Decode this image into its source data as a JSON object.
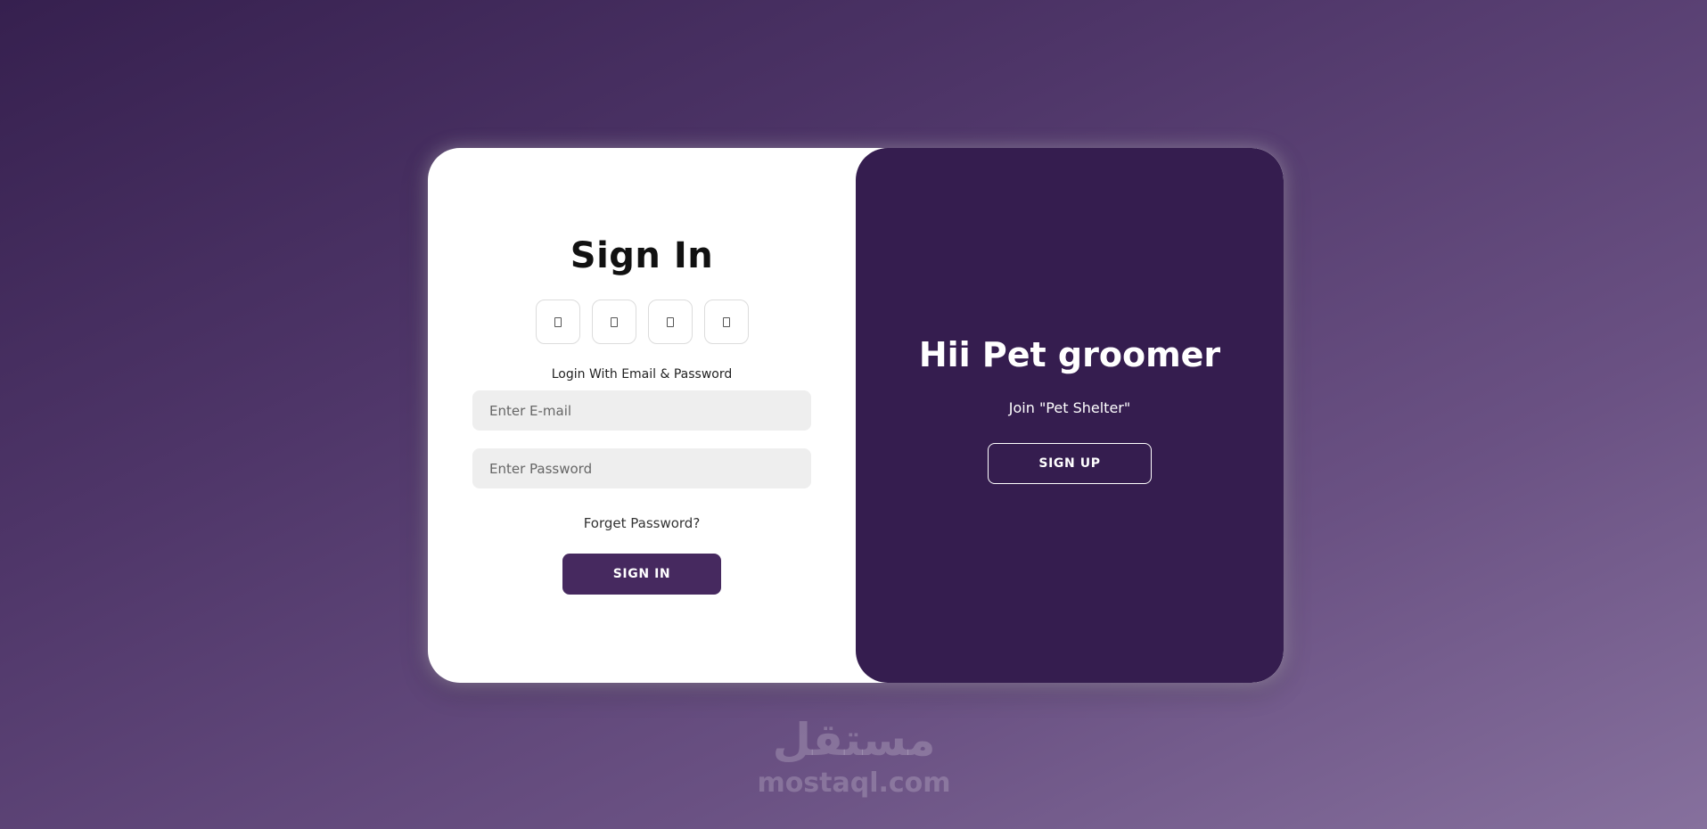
{
  "sign_in": {
    "title": "Sign In",
    "social_icons": [
      "social-icon-1",
      "social-icon-2",
      "social-icon-3",
      "social-icon-4"
    ],
    "subtitle": "Login With Email & Password",
    "email_placeholder": "Enter E-mail",
    "password_placeholder": "Enter Password",
    "forget_label": "Forget Password?",
    "button_label": "SIGN IN"
  },
  "welcome": {
    "title": "Hii Pet groomer",
    "subtitle": "Join \"Pet Shelter\"",
    "button_label": "SIGN UP"
  },
  "watermark": {
    "arabic": "مستقل",
    "latin": "mostaql.com"
  },
  "colors": {
    "accent": "#46295f",
    "panel": "#351d4f",
    "background_start": "#36204f",
    "background_end": "#86709d"
  }
}
